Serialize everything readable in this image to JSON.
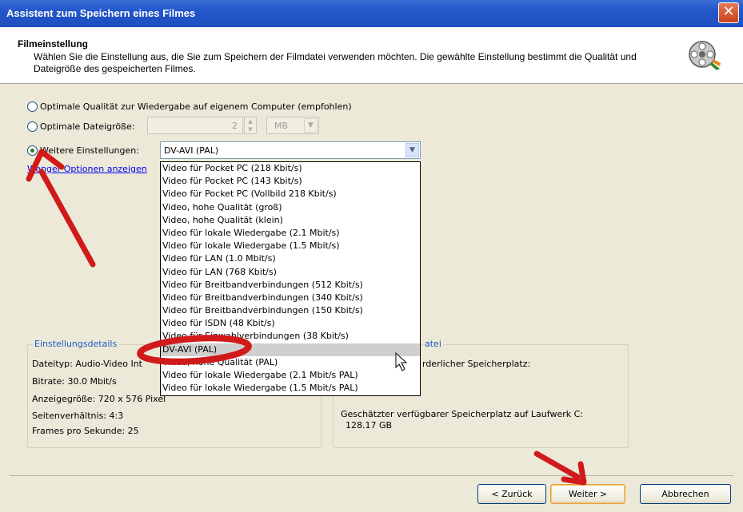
{
  "window": {
    "title": "Assistent zum Speichern eines Filmes",
    "close_glyph": "✕"
  },
  "header": {
    "heading": "Filmeinstellung",
    "description": "Wählen Sie die Einstellung aus, die Sie zum Speichern der Filmdatei verwenden möchten. Die gewählte Einstellung bestimmt die Qualität und Dateigröße des gespeicherten Filmes.",
    "icon": "film-reel-icon"
  },
  "options": {
    "best_quality_label": "Optimale Qualität zur Wiedergabe auf eigenem Computer (empfohlen)",
    "best_size_label": "Optimale Dateigröße:",
    "size_value": "2",
    "size_unit": "MB",
    "more_settings_label": "Weitere Einstellungen:",
    "more_settings_value": "DV-AVI (PAL)",
    "selected_option": "Weitere Einstellungen:"
  },
  "link": {
    "fewer_options_visible": "Wen",
    "fewer_options_tail": "ger Optionen anzeigen"
  },
  "dropdown": {
    "items": [
      "Video für Pocket PC (218 Kbit/s)",
      "Video für Pocket PC (143 Kbit/s)",
      "Video für Pocket PC (Vollbild 218 Kbit/s)",
      "Video, hohe Qualität (groß)",
      "Video, hohe Qualität (klein)",
      "Video für lokale Wiedergabe (2.1 Mbit/s)",
      "Video für lokale Wiedergabe (1.5 Mbit/s)",
      "Video für LAN (1.0 Mbit/s)",
      "Video für LAN (768 Kbit/s)",
      "Video für Breitbandverbindungen (512 Kbit/s)",
      "Video für Breitbandverbindungen (340 Kbit/s)",
      "Video für Breitbandverbindungen (150 Kbit/s)",
      "Video für ISDN (48 Kbit/s)",
      "Video für Einwahlverbindungen (38 Kbit/s)",
      "DV-AVI (PAL)",
      "Video, hohe Qualität (PAL)",
      "Video für lokale Wiedergabe (2.1 Mbit/s PAL)",
      "Video für lokale Wiedergabe (1.5 Mbit/s PAL)"
    ],
    "selected_index": 14
  },
  "details": {
    "group_title": "Einstellungsdetails",
    "file_type": "Dateityp: Audio-Video Int",
    "bitrate": "Bitrate: 30.0 Mbit/s",
    "display_size": "Anzeigegröße: 720 x 576 Pixel",
    "aspect": "Seitenverhältnis: 4:3",
    "fps": "Frames pro Sekunde: 25"
  },
  "file_info": {
    "group_title_tail": "atei",
    "required_space_tail": "rderlicher Speicherplatz:",
    "available_label": "Geschätzter verfügbarer Speicherplatz auf Laufwerk C:",
    "available_value": "128.17 GB"
  },
  "buttons": {
    "back": "< Zurück",
    "next": "Weiter >",
    "cancel": "Abbrechen"
  },
  "colors": {
    "annotation_red": "#d11a1a",
    "title_blue": "#2356c9",
    "link_blue": "#0000ee",
    "group_title_blue": "#1f5cc4"
  }
}
